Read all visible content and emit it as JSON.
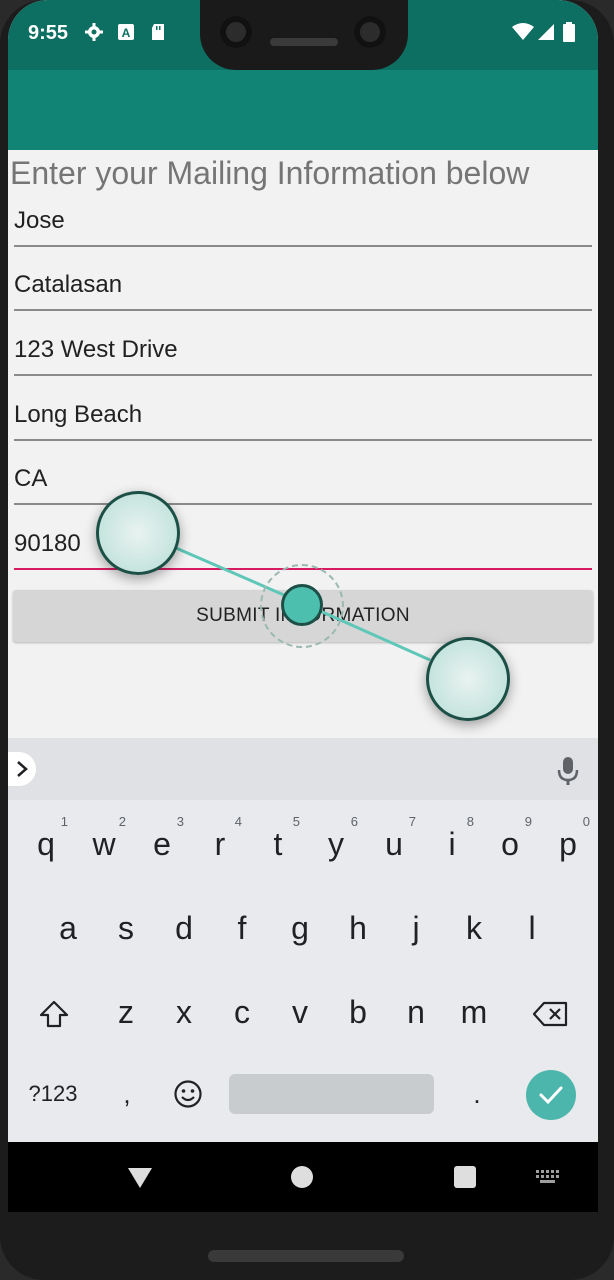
{
  "status_bar": {
    "time": "9:55",
    "left_icons": [
      "gear-icon",
      "font-a-icon",
      "sd-card-icon"
    ],
    "right_icons": [
      "wifi-icon",
      "signal-icon",
      "battery-icon"
    ]
  },
  "colors": {
    "status_bar": "#0d6e62",
    "app_bar": "#128476",
    "focused_underline": "#d81b60",
    "keyboard_accent": "#4db6ac"
  },
  "form": {
    "heading": "Enter your Mailing Information below",
    "fields": [
      {
        "name": "first-name-field",
        "value": "Jose"
      },
      {
        "name": "last-name-field",
        "value": "Catalasan"
      },
      {
        "name": "street-address-field",
        "value": "123 West Drive"
      },
      {
        "name": "city-field",
        "value": "Long Beach"
      },
      {
        "name": "state-field",
        "value": "CA"
      },
      {
        "name": "zip-code-field",
        "value": "90180",
        "focused": true
      }
    ],
    "submit_label": "SUBMIT INFORMATION"
  },
  "keyboard": {
    "row1": [
      {
        "key": "q",
        "hint": "1"
      },
      {
        "key": "w",
        "hint": "2"
      },
      {
        "key": "e",
        "hint": "3"
      },
      {
        "key": "r",
        "hint": "4"
      },
      {
        "key": "t",
        "hint": "5"
      },
      {
        "key": "y",
        "hint": "6"
      },
      {
        "key": "u",
        "hint": "7"
      },
      {
        "key": "i",
        "hint": "8"
      },
      {
        "key": "o",
        "hint": "9"
      },
      {
        "key": "p",
        "hint": "0"
      }
    ],
    "row2": [
      "a",
      "s",
      "d",
      "f",
      "g",
      "h",
      "j",
      "k",
      "l"
    ],
    "row3": [
      "z",
      "x",
      "c",
      "v",
      "b",
      "n",
      "m"
    ],
    "symbols_label": "?123",
    "comma": ",",
    "period": ".",
    "icons": [
      "chevron-right-icon",
      "mic-icon",
      "shift-icon",
      "backspace-icon",
      "emoji-icon",
      "check-icon"
    ]
  },
  "nav_bar": {
    "icons": [
      "back-icon",
      "home-icon",
      "recents-icon",
      "keyboard-switch-icon"
    ]
  }
}
